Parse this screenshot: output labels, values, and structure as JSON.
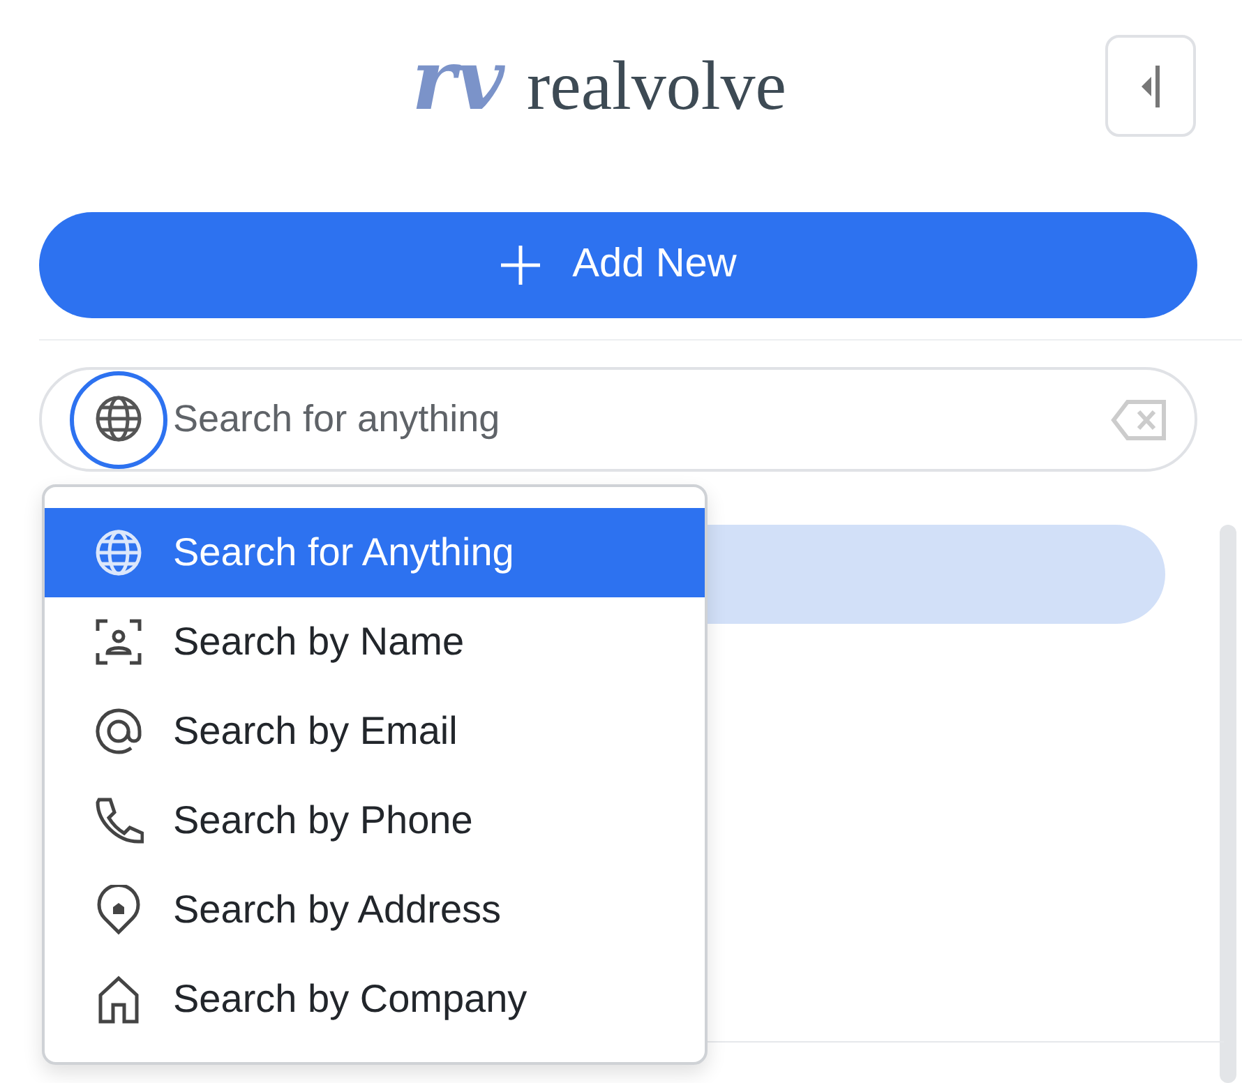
{
  "header": {
    "logo_mark": "rv",
    "logo_text": "realvolve"
  },
  "add_button": {
    "label": "Add New"
  },
  "search": {
    "placeholder": "Search for anything"
  },
  "search_menu": {
    "items": [
      {
        "label": "Search for Anything",
        "kind": "globe",
        "selected": true
      },
      {
        "label": "Search by Name",
        "kind": "person",
        "selected": false
      },
      {
        "label": "Search by Email",
        "kind": "at",
        "selected": false
      },
      {
        "label": "Search by Phone",
        "kind": "phone",
        "selected": false
      },
      {
        "label": "Search by Address",
        "kind": "pin",
        "selected": false
      },
      {
        "label": "Search by Company",
        "kind": "house",
        "selected": false
      }
    ]
  }
}
